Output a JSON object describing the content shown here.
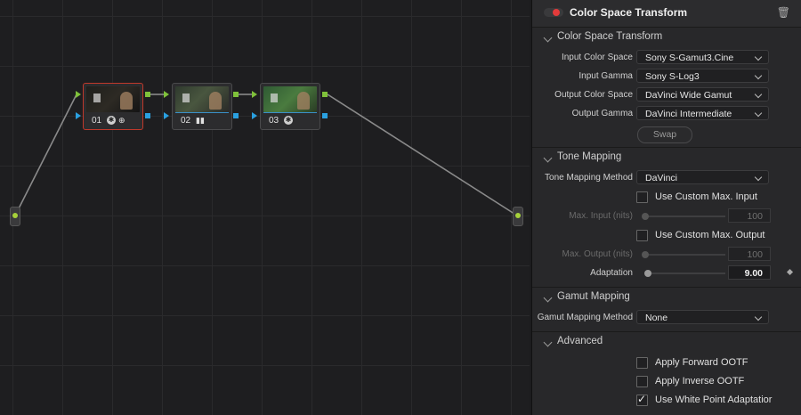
{
  "graph": {
    "nodes": [
      {
        "label": "01",
        "icons": [
          "fx-badge",
          "convert-icon"
        ]
      },
      {
        "label": "02",
        "icons": [
          "bars-icon"
        ]
      },
      {
        "label": "03",
        "icons": [
          "fx-badge"
        ]
      }
    ],
    "colors": {
      "link": "#8a8a8a",
      "rgb_port": "#7fc13a",
      "alpha_port": "#2aa0e0",
      "selected": "#c0392b"
    }
  },
  "panel": {
    "title": "Color Space Transform",
    "sections": {
      "cst": {
        "title": "Color Space Transform",
        "input_color_space_label": "Input Color Space",
        "input_color_space_value": "Sony S-Gamut3.Cine",
        "input_gamma_label": "Input Gamma",
        "input_gamma_value": "Sony S-Log3",
        "output_color_space_label": "Output Color Space",
        "output_color_space_value": "DaVinci Wide Gamut",
        "output_gamma_label": "Output Gamma",
        "output_gamma_value": "DaVinci Intermediate",
        "swap_label": "Swap"
      },
      "tone": {
        "title": "Tone Mapping",
        "method_label": "Tone Mapping Method",
        "method_value": "DaVinci",
        "custom_max_input_label": "Use Custom Max. Input",
        "max_input_label": "Max. Input (nits)",
        "max_input_value": "100",
        "custom_max_output_label": "Use Custom Max. Output",
        "max_output_label": "Max. Output (nits)",
        "max_output_value": "100",
        "adaptation_label": "Adaptation",
        "adaptation_value": "9.00"
      },
      "gamut": {
        "title": "Gamut Mapping",
        "method_label": "Gamut Mapping Method",
        "method_value": "None"
      },
      "advanced": {
        "title": "Advanced",
        "forward_ootf_label": "Apply Forward OOTF",
        "inverse_ootf_label": "Apply Inverse OOTF",
        "white_point_label": "Use White Point Adaptatior",
        "forward_ootf_checked": false,
        "inverse_ootf_checked": false,
        "white_point_checked": true
      }
    },
    "colors": {
      "enable_toggle": "#e23b3b"
    }
  }
}
